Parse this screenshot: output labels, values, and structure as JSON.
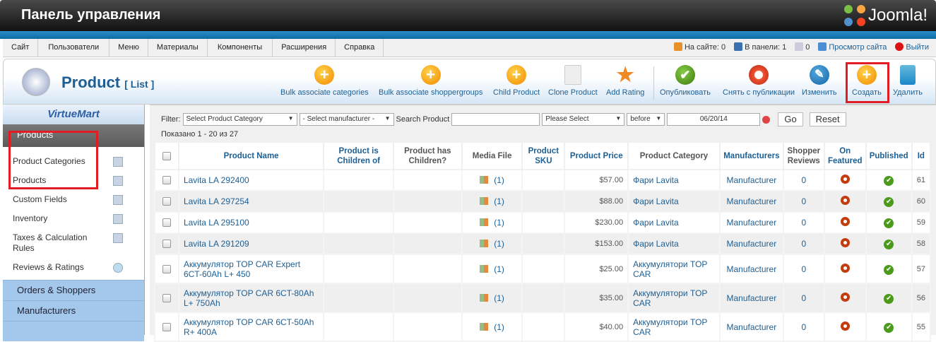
{
  "header": {
    "title": "Панель управления",
    "brand": "Joomla!"
  },
  "menu": [
    "Сайт",
    "Пользователи",
    "Меню",
    "Материалы",
    "Компоненты",
    "Расширения",
    "Справка"
  ],
  "status": {
    "on_site": "На сайте: 0",
    "in_panel": "В панели: 1",
    "messages": "0",
    "view_site": "Просмотр сайта",
    "logout": "Выйти"
  },
  "toolbar": {
    "title": "Product",
    "subtitle": "[ List ]",
    "buttons": [
      "Bulk associate categories",
      "Bulk associate shoppergroups",
      "Child Product",
      "Clone Product",
      "Add Rating",
      "Опубликовать",
      "Снять с публикации",
      "Изменить",
      "Создать",
      "Удалить"
    ]
  },
  "sidebar": {
    "logo": "VirtueMart",
    "category": "Products",
    "items": [
      "Product Categories",
      "Products",
      "Custom Fields",
      "Inventory",
      "Taxes & Calculation Rules",
      "Reviews & Ratings"
    ],
    "groups": [
      "Orders & Shoppers",
      "Manufacturers"
    ]
  },
  "filter": {
    "label": "Filter:",
    "category": "Select Product Category",
    "manufacturer": "- Select manufacturer -",
    "search_label": "Search Product",
    "search_value": "",
    "please_select": "Please Select",
    "before": "before",
    "date": "06/20/14",
    "go": "Go",
    "reset": "Reset"
  },
  "shown": "Показано 1 - 20 из 27",
  "columns": [
    "Product Name",
    "Product is Children of",
    "Product has Children?",
    "Media File",
    "Product SKU",
    "Product Price",
    "Product Category",
    "Manufacturers",
    "Shopper Reviews",
    "On Featured",
    "Published",
    "Id"
  ],
  "rows": [
    {
      "name": "Lavita LA 292400",
      "media": "(1)",
      "price": "$57.00",
      "category": "Фари Lavita",
      "manufacturer": "Manufacturer",
      "reviews": "0",
      "id": "61"
    },
    {
      "name": "Lavita LA 297254",
      "media": "(1)",
      "price": "$88.00",
      "category": "Фари Lavita",
      "manufacturer": "Manufacturer",
      "reviews": "0",
      "id": "60"
    },
    {
      "name": "Lavita LA 295100",
      "media": "(1)",
      "price": "$230.00",
      "category": "Фари Lavita",
      "manufacturer": "Manufacturer",
      "reviews": "0",
      "id": "59"
    },
    {
      "name": "Lavita LA 291209",
      "media": "(1)",
      "price": "$153.00",
      "category": "Фари Lavita",
      "manufacturer": "Manufacturer",
      "reviews": "0",
      "id": "58"
    },
    {
      "name": "Аккумулятор TOP CAR Expert 6CT-60Ah L+ 450",
      "media": "(1)",
      "price": "$25.00",
      "category": "Аккумулятори TOP CAR",
      "manufacturer": "Manufacturer",
      "reviews": "0",
      "id": "57"
    },
    {
      "name": "Аккумулятор TOP CAR 6CT-80Ah L+ 750Ah",
      "media": "(1)",
      "price": "$35.00",
      "category": "Аккумулятори TOP CAR",
      "manufacturer": "Manufacturer",
      "reviews": "0",
      "id": "56"
    },
    {
      "name": "Аккумулятор TOP CAR 6CT-50Ah R+ 400A",
      "media": "(1)",
      "price": "$40.00",
      "category": "Аккумулятори TOP CAR",
      "manufacturer": "Manufacturer",
      "reviews": "0",
      "id": "55"
    }
  ]
}
